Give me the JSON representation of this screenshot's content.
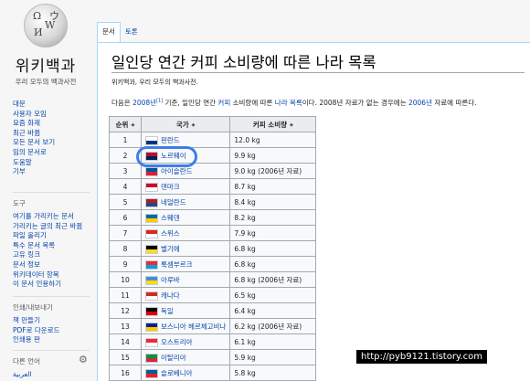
{
  "logo": {
    "wordmark": "위키백과",
    "tagline": "우리 모두의 백과사전"
  },
  "sidebar": {
    "main": [
      "대문",
      "사용자 모임",
      "요즘 화제",
      "최근 바뀜",
      "모든 문서 보기",
      "임의 문서로",
      "도움말",
      "기부"
    ],
    "tools_heading": "도구",
    "tools": [
      "여기를 가리키는 문서",
      "가리키는 글의 최근 바뀜",
      "파일 올리기",
      "특수 문서 목록",
      "고유 링크",
      "문서 정보",
      "위키데이터 항목",
      "이 문서 인용하기"
    ],
    "print_heading": "인쇄/내보내기",
    "print": [
      "책 만들기",
      "PDF로 다운로드",
      "인쇄용 판"
    ],
    "lang_heading": "다른 언어",
    "lang": [
      "العربية"
    ]
  },
  "tabs": {
    "article": "문서",
    "talk": "토론"
  },
  "page": {
    "title": "일인당 연간 커피 소비량에 따른 나라 목록",
    "from": "위키백과, 우리 모두의 백과사전.",
    "intro": {
      "p1": "다음은 ",
      "link1": "2008년",
      "ref": "[1]",
      "p2": " 기준, 일인당 연간 ",
      "link2": "커피",
      "p3": " 소비량에 따른 ",
      "link3": "나라 목록",
      "p4": "이다. 2008년 자료가 없는 경우에는 ",
      "link4": "2006년",
      "p5": " 자료에 따른다."
    }
  },
  "table": {
    "headers": [
      "순위",
      "국가",
      "커피 소비량"
    ],
    "rows": [
      {
        "rank": "1",
        "country": "핀란드",
        "value": "12.0 kg",
        "flag": [
          "#ffffff",
          "#003580"
        ]
      },
      {
        "rank": "2",
        "country": "노르웨이",
        "value": "9.9 kg",
        "flag": [
          "#ba0c2f",
          "#00205b"
        ]
      },
      {
        "rank": "3",
        "country": "아이슬란드",
        "value": "9.0 kg (2006년 자료)",
        "flag": [
          "#02529c",
          "#dc1e35"
        ]
      },
      {
        "rank": "4",
        "country": "덴마크",
        "value": "8.7 kg",
        "flag": [
          "#c8102e",
          "#ffffff"
        ]
      },
      {
        "rank": "5",
        "country": "네덜란드",
        "value": "8.4 kg",
        "flag": [
          "#ae1c28",
          "#21468b"
        ]
      },
      {
        "rank": "6",
        "country": "스웨덴",
        "value": "8.2 kg",
        "flag": [
          "#006aa7",
          "#fecc00"
        ]
      },
      {
        "rank": "7",
        "country": "스위스",
        "value": "7.9 kg",
        "flag": [
          "#d52b1e",
          "#ffffff"
        ]
      },
      {
        "rank": "8",
        "country": "벨기에",
        "value": "6.8 kg",
        "flag": [
          "#000000",
          "#fdda24"
        ]
      },
      {
        "rank": "9",
        "country": "룩셈부르크",
        "value": "6.8 kg",
        "flag": [
          "#ed2939",
          "#00a1de"
        ]
      },
      {
        "rank": "10",
        "country": "아루바",
        "value": "6.8 kg (2006년 자료)",
        "flag": [
          "#418fde",
          "#fcdd09"
        ]
      },
      {
        "rank": "11",
        "country": "캐나다",
        "value": "6.5 kg",
        "flag": [
          "#d52b1e",
          "#ffffff"
        ]
      },
      {
        "rank": "12",
        "country": "독일",
        "value": "6.4 kg",
        "flag": [
          "#000000",
          "#dd0000"
        ]
      },
      {
        "rank": "13",
        "country": "보스니아 헤르체고비나",
        "value": "6.2 kg (2006년 자료)",
        "flag": [
          "#002395",
          "#fecb00"
        ]
      },
      {
        "rank": "14",
        "country": "오스트리아",
        "value": "6.1 kg",
        "flag": [
          "#ed2939",
          "#ffffff"
        ]
      },
      {
        "rank": "15",
        "country": "이탈리아",
        "value": "5.9 kg",
        "flag": [
          "#009246",
          "#ce2b37"
        ]
      },
      {
        "rank": "16",
        "country": "슬로베니아",
        "value": "5.8 kg",
        "flag": [
          "#005da4",
          "#ed1c24"
        ]
      }
    ]
  },
  "watermark": "http://pyb9121.tistory.com"
}
